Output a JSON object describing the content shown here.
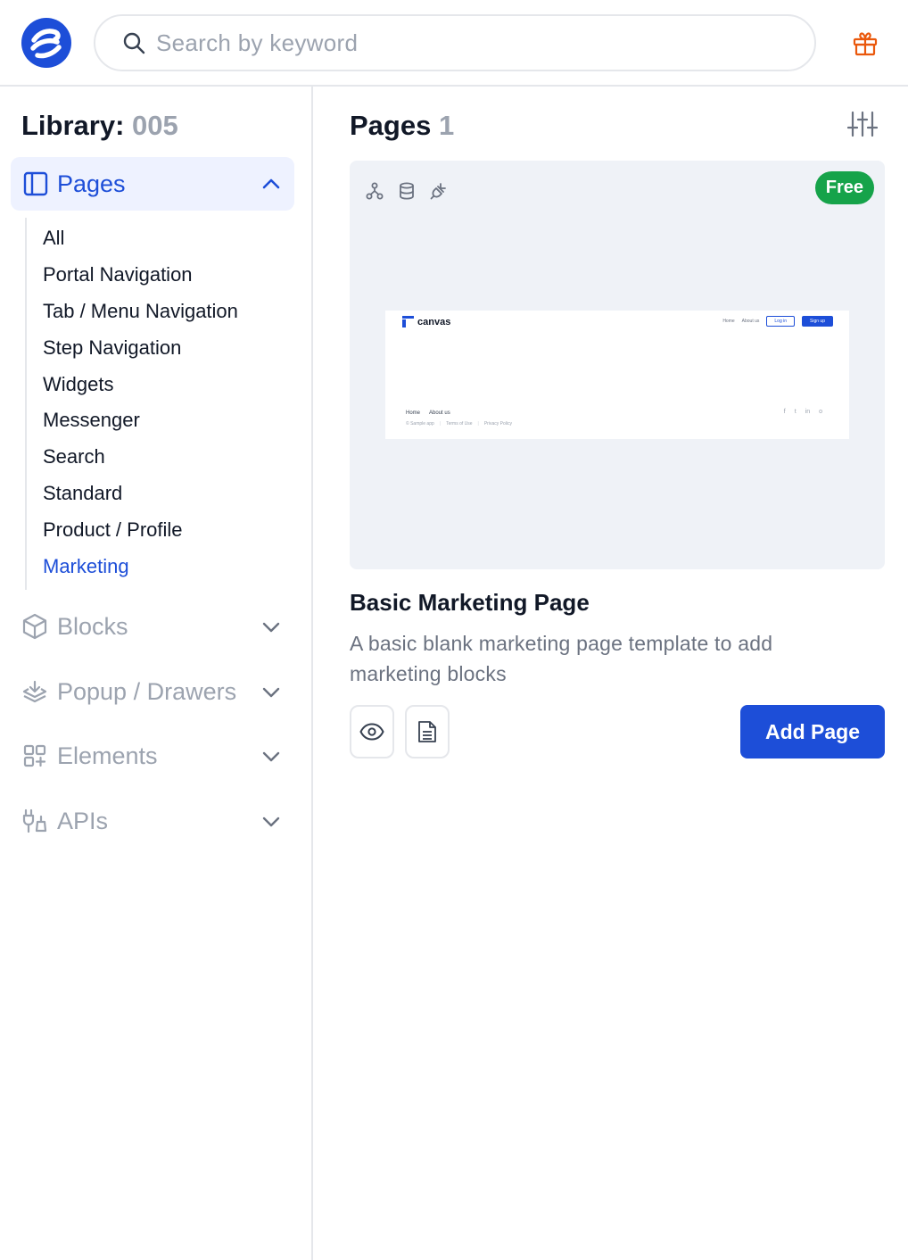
{
  "header": {
    "search_placeholder": "Search by keyword",
    "icons": {
      "logo": "brand-logo",
      "search": "search-icon",
      "gift": "gift-icon"
    }
  },
  "sidebar": {
    "library_label": "Library:",
    "library_count": "005",
    "sections": [
      {
        "label": "Pages",
        "icon": "layout-panel-icon",
        "expanded": true
      },
      {
        "label": "Blocks",
        "icon": "cube-icon",
        "expanded": false
      },
      {
        "label": "Popup / Drawers",
        "icon": "layers-icon",
        "expanded": false
      },
      {
        "label": "Elements",
        "icon": "grid-plus-icon",
        "expanded": false
      },
      {
        "label": "APIs",
        "icon": "plug-icon",
        "expanded": false
      }
    ],
    "page_categories": [
      "All",
      "Portal Navigation",
      "Tab / Menu Navigation",
      "Step Navigation",
      "Widgets",
      "Messenger",
      "Search",
      "Standard",
      "Product / Profile",
      "Marketing"
    ],
    "active_category": "Marketing"
  },
  "main": {
    "title": "Pages",
    "count": "1",
    "card": {
      "badge": "Free",
      "title": "Basic Marketing Page",
      "description": "A basic blank marketing page template to add marketing blocks",
      "add_label": "Add Page",
      "preview": {
        "brand": "canvas",
        "nav": [
          "Home",
          "About us"
        ],
        "login": "Log in",
        "signup": "Sign up",
        "footer_links": [
          "Home",
          "About us"
        ],
        "footer_legal": [
          "© Sample app",
          "Terms of Use",
          "Privacy Policy"
        ],
        "social": [
          "f",
          "t",
          "in",
          "o"
        ]
      }
    }
  },
  "colors": {
    "accent": "#1d4ed8",
    "active_bg": "#eef2ff",
    "badge": "#16a34a",
    "muted": "#9ca3af",
    "gift": "#ea580c"
  }
}
